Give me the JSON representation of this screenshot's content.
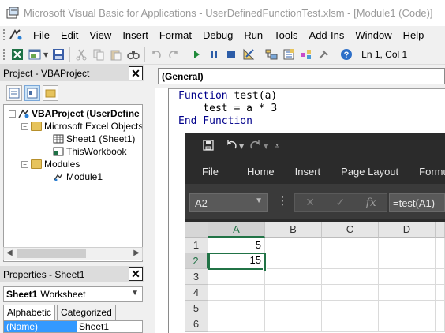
{
  "window": {
    "title": "Microsoft Visual Basic for Applications - UserDefinedFunctionTest.xlsm - [Module1 (Code)]"
  },
  "menu": [
    "File",
    "Edit",
    "View",
    "Insert",
    "Format",
    "Debug",
    "Run",
    "Tools",
    "Add-Ins",
    "Window",
    "Help"
  ],
  "toolbar": {
    "icons": [
      "view-excel-icon",
      "insert-module-icon",
      "save-icon",
      "cut-icon",
      "copy-icon",
      "paste-icon",
      "find-icon",
      "undo-icon",
      "redo-icon",
      "run-icon",
      "break-icon",
      "reset-icon",
      "design-mode-icon",
      "project-explorer-icon",
      "properties-icon",
      "object-browser-icon",
      "toolbox-icon",
      "help-icon"
    ],
    "position": "Ln 1, Col 1"
  },
  "project_panel": {
    "title": "Project - VBAProject",
    "close": "✕",
    "tree": [
      {
        "label": "VBAProject (UserDefine",
        "bold": true,
        "level": 0,
        "expander": "−"
      },
      {
        "label": "Microsoft Excel Objects",
        "level": 1,
        "expander": "−"
      },
      {
        "label": "Sheet1 (Sheet1)",
        "level": 2
      },
      {
        "label": "ThisWorkbook",
        "level": 2
      },
      {
        "label": "Modules",
        "level": 1,
        "expander": "−"
      },
      {
        "label": "Module1",
        "level": 2
      }
    ]
  },
  "properties_panel": {
    "title": "Properties - Sheet1",
    "close": "✕",
    "object_name": "Sheet1",
    "object_type": "Worksheet",
    "tabs": [
      "Alphabetic",
      "Categorized"
    ],
    "row": {
      "name": "(Name)",
      "value": "Sheet1"
    }
  },
  "code_window": {
    "object_combo": "(General)",
    "lines": [
      {
        "kw": "Function",
        "rest": " test(a)"
      },
      {
        "kw": "",
        "rest": "    test = a * 3"
      },
      {
        "kw": "End Function",
        "rest": ""
      }
    ]
  },
  "excel": {
    "ribbon_tabs": [
      "File",
      "Home",
      "Insert",
      "Page Layout",
      "Formulas"
    ],
    "name_box": "A2",
    "formula": "=test(A1)",
    "fx": "fx",
    "columns": [
      "A",
      "B",
      "C",
      "D"
    ],
    "rows": [
      "1",
      "2",
      "3",
      "4",
      "5",
      "6"
    ],
    "cells": {
      "A1": "5",
      "A2": "15"
    },
    "accent": "#217346"
  }
}
